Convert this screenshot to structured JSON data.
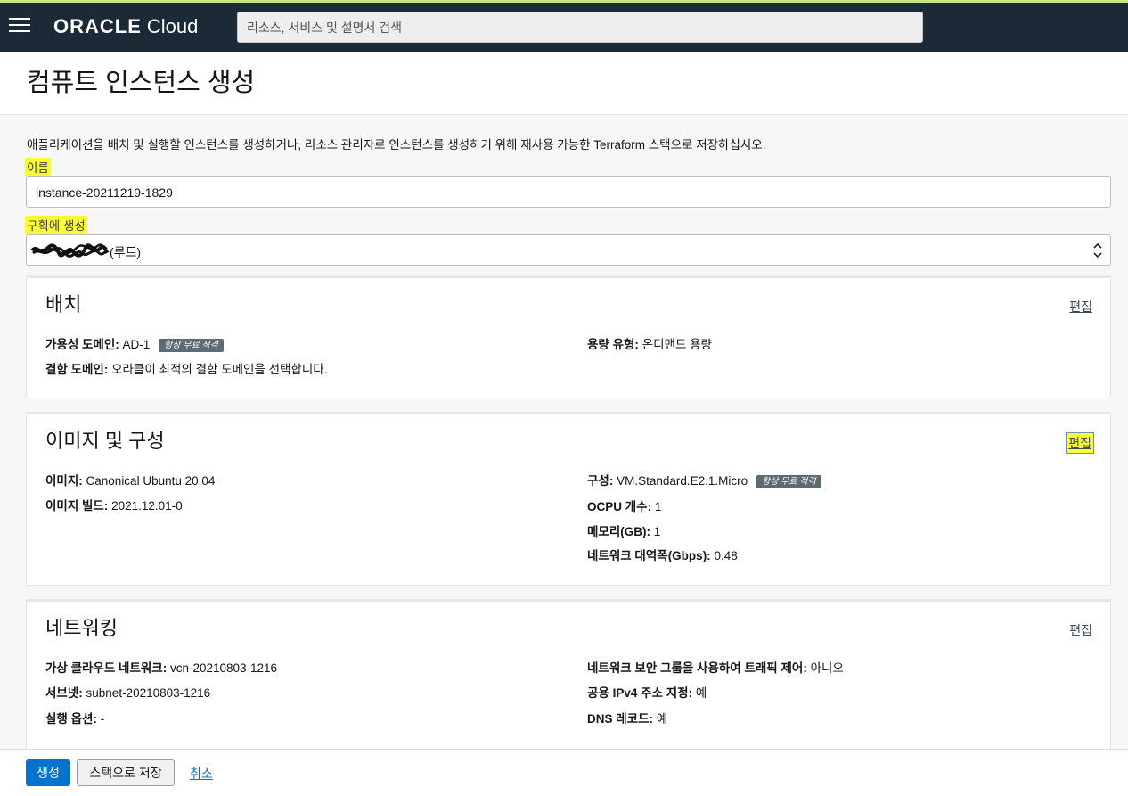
{
  "topbar": {
    "brand": "ORACLE",
    "product": "Cloud",
    "search_placeholder": "리소스, 서비스 및 설명서 검색"
  },
  "page": {
    "title": "컴퓨트 인스턴스 생성",
    "intro": "애플리케이션을 배치 및 실행할 인스턴스를 생성하거나, 리소스 관리자로 인스턴스를 생성하기 위해 재사용 가능한 Terraform 스택으로 저장하십시오."
  },
  "form": {
    "name_label": "이름",
    "name_value": "instance-20211219-1829",
    "compartment_label": "구획에 생성",
    "compartment_suffix": "(루트)"
  },
  "placement": {
    "title": "배치",
    "edit": "편집",
    "ad_key": "가용성 도메인:",
    "ad_value": "AD-1",
    "ad_badge": "항상 무료 적격",
    "capacity_key": "용량 유형:",
    "capacity_value": "온디맨드 용량",
    "fd_key": "결함 도메인:",
    "fd_value": "오라클이 최적의 결함 도메인을 선택합니다."
  },
  "image": {
    "title": "이미지 및 구성",
    "edit": "편집",
    "image_key": "이미지:",
    "image_value": "Canonical Ubuntu 20.04",
    "build_key": "이미지 빌드:",
    "build_value": "2021.12.01-0",
    "shape_key": "구성:",
    "shape_value": "VM.Standard.E2.1.Micro",
    "shape_badge": "항상 무료 적격",
    "ocpu_key": "OCPU 개수:",
    "ocpu_value": "1",
    "memory_key": "메모리(GB):",
    "memory_value": "1",
    "bandwidth_key": "네트워크 대역폭(Gbps):",
    "bandwidth_value": "0.48"
  },
  "networking": {
    "title": "네트워킹",
    "edit": "편집",
    "vcn_key": "가상 클라우드 네트워크:",
    "vcn_value": "vcn-20210803-1216",
    "subnet_key": "서브넷:",
    "subnet_value": "subnet-20210803-1216",
    "launch_key": "실행 옵션:",
    "launch_value": "-",
    "nsg_key": "네트워크 보안 그룹을 사용하여 트래픽 제어:",
    "nsg_value": "아니오",
    "ipv4_key": "공용 IPv4 주소 지정:",
    "ipv4_value": "예",
    "dns_key": "DNS 레코드:",
    "dns_value": "예"
  },
  "footer": {
    "create": "생성",
    "save_stack": "스택으로 저장",
    "cancel": "취소"
  },
  "colors": {
    "topbar": "#1b2a36",
    "primary": "#0572ce",
    "highlight": "#fbfb3c"
  }
}
